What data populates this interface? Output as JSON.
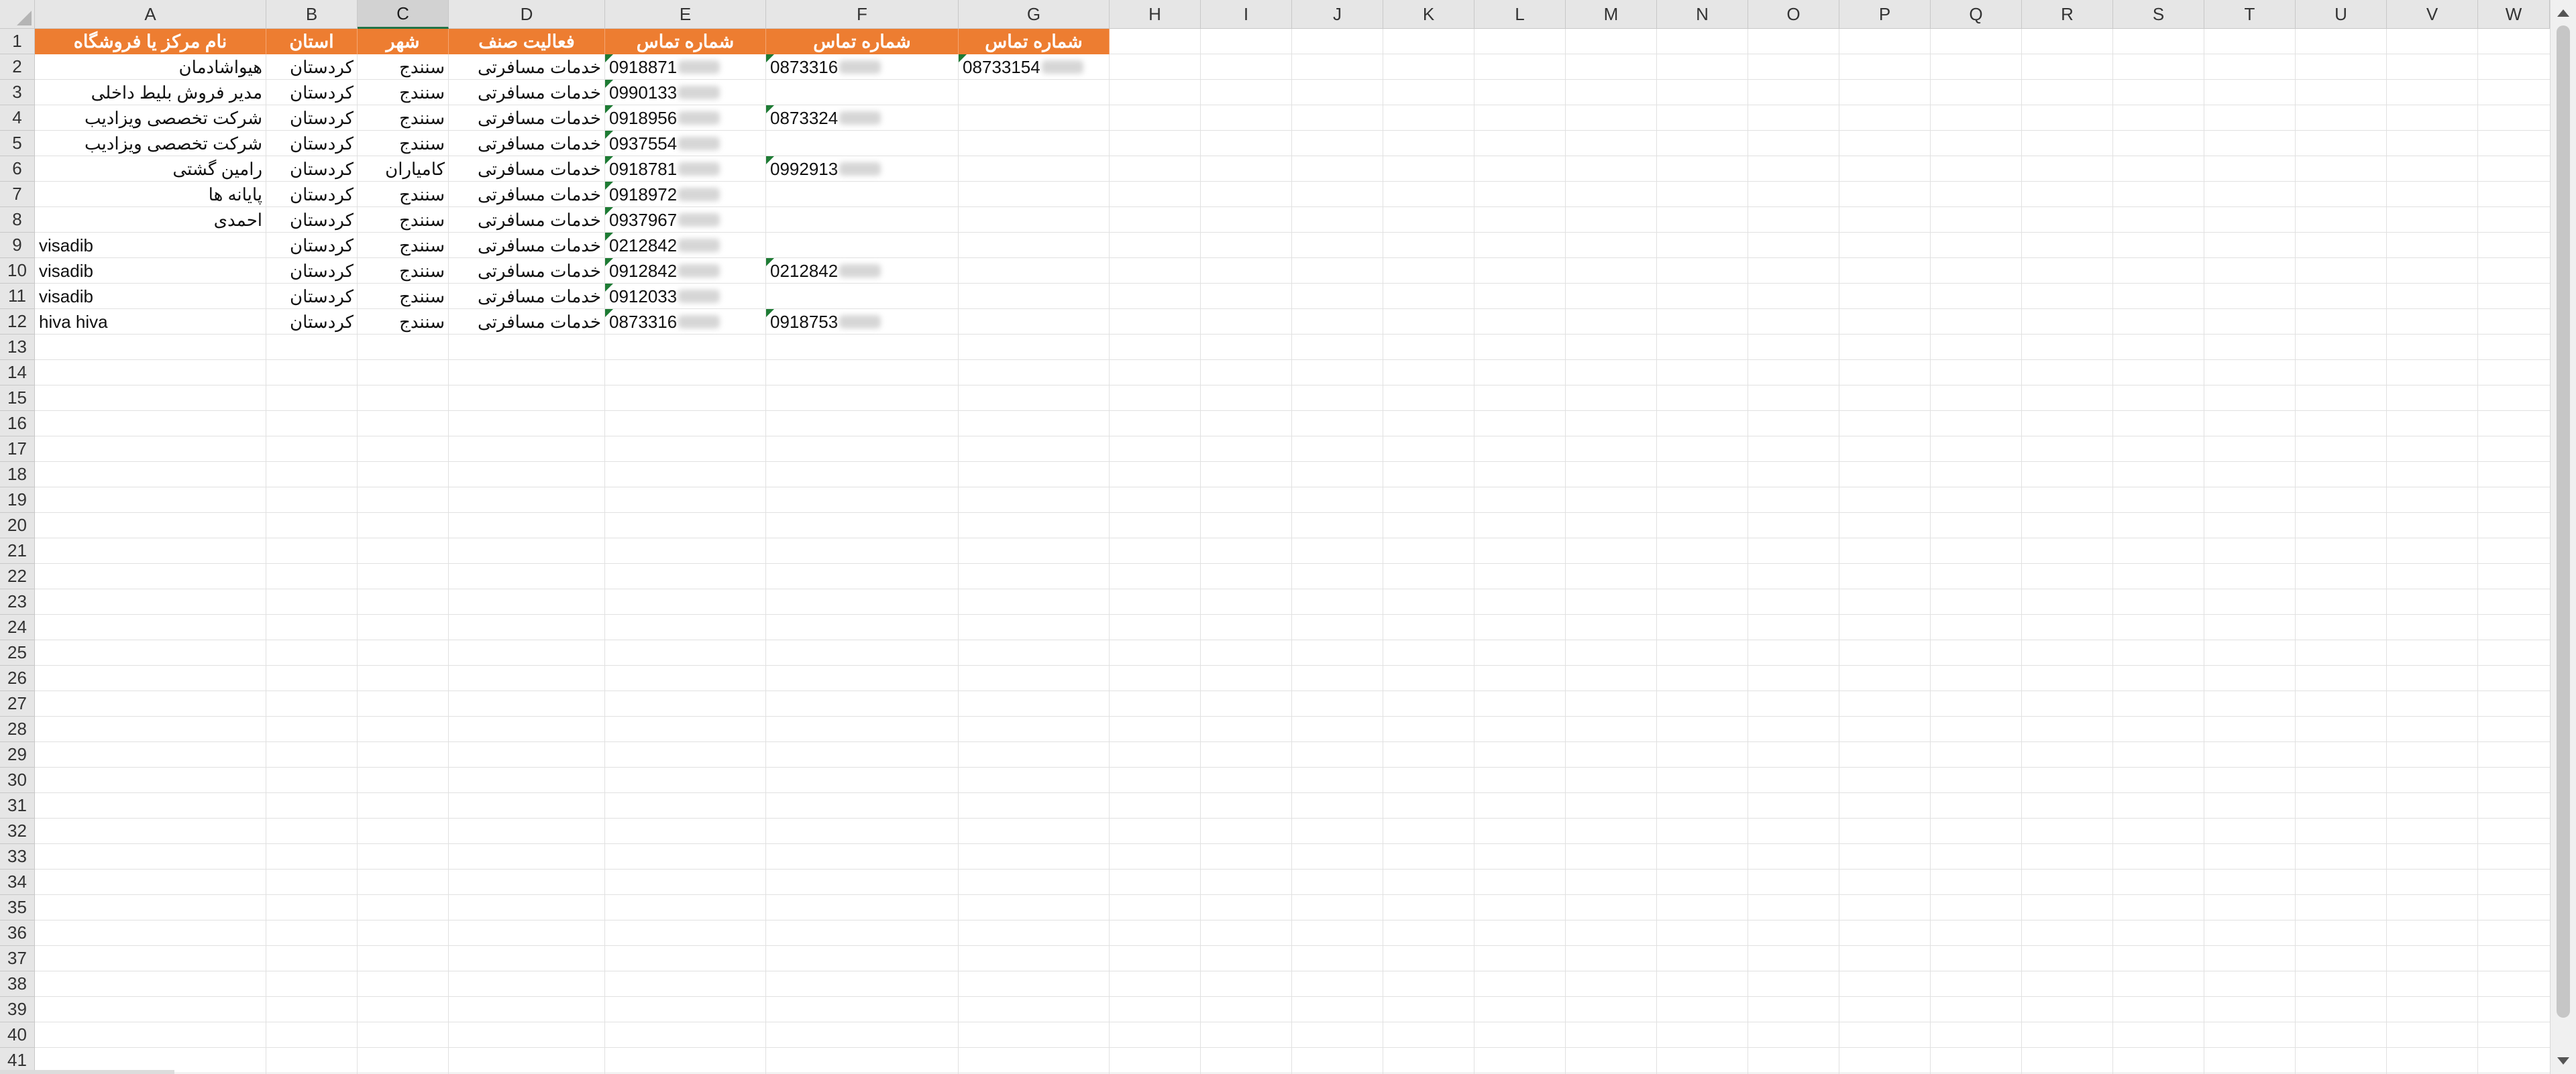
{
  "columns": [
    "A",
    "B",
    "C",
    "D",
    "E",
    "F",
    "G",
    "H",
    "I",
    "J",
    "K",
    "L",
    "M",
    "N",
    "O",
    "P",
    "Q",
    "R",
    "S",
    "T",
    "U",
    "V",
    "W"
  ],
  "selected_column": "C",
  "row_numbers": [
    "1",
    "2",
    "3",
    "4",
    "5",
    "6",
    "7",
    "8",
    "9",
    "10",
    "11",
    "12",
    "13",
    "14",
    "15",
    "16",
    "17",
    "18",
    "19",
    "20",
    "21",
    "22",
    "23",
    "24",
    "25",
    "26",
    "27",
    "28",
    "29",
    "30",
    "31",
    "32",
    "33",
    "34",
    "35",
    "36",
    "37",
    "38",
    "39",
    "40",
    "41"
  ],
  "header_row": [
    "نام مرکز یا فروشگاه",
    "استان",
    "شهر",
    "فعالیت صنف",
    "شماره تماس",
    "شماره تماس",
    "شماره تماس"
  ],
  "rows": [
    {
      "name": "هیواشادمان",
      "province": "کردستان",
      "city": "سنندج",
      "activity": "خدمات مسافرتی",
      "phone1": "0918871",
      "phone2": "0873316",
      "phone3": "08733154"
    },
    {
      "name": "مدیر فروش بلیط داخلی",
      "province": "کردستان",
      "city": "سنندج",
      "activity": "خدمات مسافرتی",
      "phone1": "0990133",
      "phone2": "",
      "phone3": ""
    },
    {
      "name": "شرکت تخصصی ویزادیب",
      "province": "کردستان",
      "city": "سنندج",
      "activity": "خدمات مسافرتی",
      "phone1": "0918956",
      "phone2": "0873324",
      "phone3": ""
    },
    {
      "name": "شرکت تخصصی ویزادیب",
      "province": "کردستان",
      "city": "سنندج",
      "activity": "خدمات مسافرتی",
      "phone1": "0937554",
      "phone2": "",
      "phone3": ""
    },
    {
      "name": "رامین گشتی",
      "province": "کردستان",
      "city": "کامیاران",
      "activity": "خدمات مسافرتی",
      "phone1": "0918781",
      "phone2": "0992913",
      "phone3": ""
    },
    {
      "name": "پایانه ها",
      "province": "کردستان",
      "city": "سنندج",
      "activity": "خدمات مسافرتی",
      "phone1": "0918972",
      "phone2": "",
      "phone3": ""
    },
    {
      "name": "احمدی",
      "province": "کردستان",
      "city": "سنندج",
      "activity": "خدمات مسافرتی",
      "phone1": "0937967",
      "phone2": "",
      "phone3": ""
    },
    {
      "name": "visadib",
      "province": "کردستان",
      "city": "سنندج",
      "activity": "خدمات مسافرتی",
      "phone1": "0212842",
      "phone2": "",
      "phone3": ""
    },
    {
      "name": "visadib",
      "province": "کردستان",
      "city": "سنندج",
      "activity": "خدمات مسافرتی",
      "phone1": "0912842",
      "phone2": "0212842",
      "phone3": ""
    },
    {
      "name": "visadib",
      "province": "کردستان",
      "city": "سنندج",
      "activity": "خدمات مسافرتی",
      "phone1": "0912033",
      "phone2": "",
      "phone3": ""
    },
    {
      "name": "hiva hiva",
      "province": "کردستان",
      "city": "سنندج",
      "activity": "خدمات مسافرتی",
      "phone1": "0873316",
      "phone2": "0918753",
      "phone3": ""
    }
  ],
  "colors": {
    "header_fill": "#ed7d31",
    "header_text": "#ffffff",
    "selected_col_accent": "#217346",
    "number_flag": "#1e7b34"
  }
}
